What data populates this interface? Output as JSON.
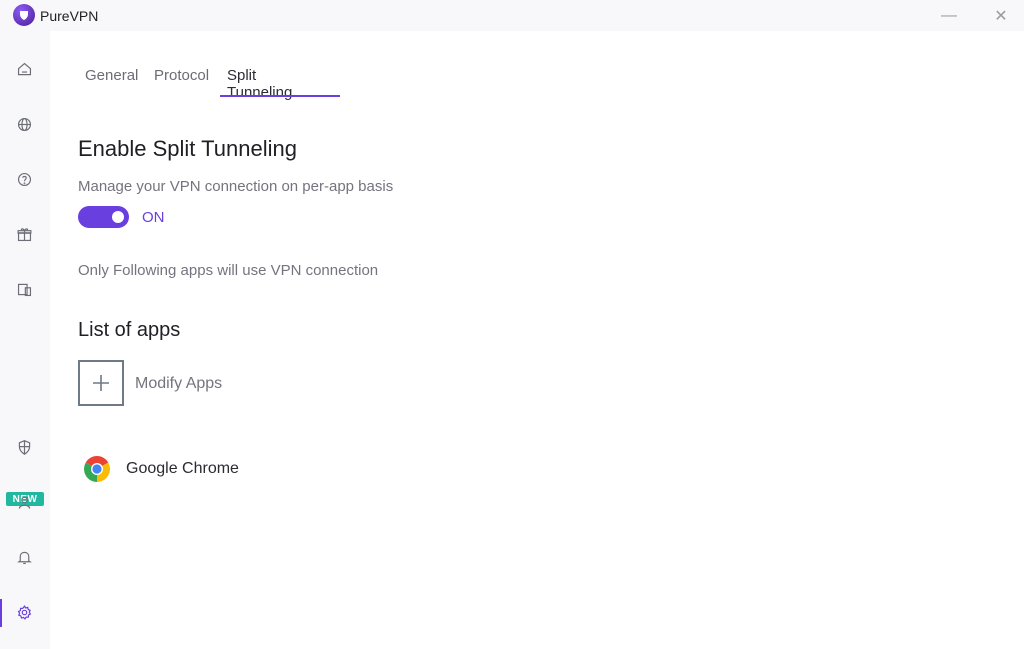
{
  "window": {
    "title": "PureVPN",
    "minimize_glyph": "—",
    "close_glyph": "✕"
  },
  "sidebar": {
    "items": [
      {
        "icon": "home-icon"
      },
      {
        "icon": "globe-icon"
      },
      {
        "icon": "help-icon"
      },
      {
        "icon": "gift-icon"
      },
      {
        "icon": "devices-icon"
      },
      {
        "icon": "shield-icon",
        "badge": "NEW"
      },
      {
        "icon": "user-icon"
      },
      {
        "icon": "bell-icon"
      },
      {
        "icon": "gear-icon",
        "active": true
      }
    ]
  },
  "tabs": [
    {
      "label": "General"
    },
    {
      "label": "Protocol"
    },
    {
      "label": "Split Tunneling",
      "active": true
    }
  ],
  "split_tunneling": {
    "heading": "Enable Split Tunneling",
    "description": "Manage your VPN connection on per-app basis",
    "toggle_state": "ON",
    "note": "Only Following apps will use VPN connection"
  },
  "apps": {
    "heading": "List of apps",
    "modify_label": "Modify Apps",
    "list": [
      {
        "name": "Google Chrome",
        "icon": "chrome-icon"
      }
    ]
  },
  "colors": {
    "accent": "#6a3fe0",
    "badge": "#22b8a0"
  }
}
